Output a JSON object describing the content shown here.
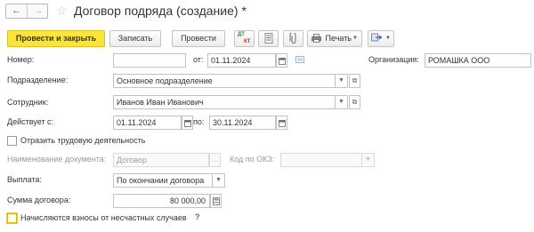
{
  "window": {
    "title": "Договор подряда (создание) *"
  },
  "nav": {
    "back": "←",
    "forward": "→"
  },
  "toolbar": {
    "post_close": "Провести и закрыть",
    "save": "Записать",
    "post": "Провести",
    "dtkt_top": "ДТ",
    "dtkt_bottom": "КТ",
    "print": "Печать"
  },
  "form": {
    "number_label": "Номер:",
    "number_value": "",
    "from_label": "от:",
    "date_value": "01.11.2024",
    "organization_label": "Организация:",
    "organization_value": "РОМАШКА ООО",
    "department_label": "Подразделение:",
    "department_value": "Основное подразделение",
    "employee_label": "Сотрудник:",
    "employee_value": "Иванов Иван Иванович",
    "valid_label": "Действует с:",
    "valid_from": "01.11.2024",
    "to_label": "по:",
    "valid_to": "30.11.2024",
    "labor_checkbox_label": "Отразить трудовую деятельность",
    "doc_name_label": "Наименование документа:",
    "doc_name_value": "Договор",
    "okz_label": "Код по ОКЗ:",
    "okz_value": "",
    "payment_label": "Выплата:",
    "payment_value": "По окончании договора",
    "sum_label": "Сумма договора:",
    "sum_value": "80 000,00",
    "accident_checkbox_label": "Начисляются взносы от несчастных случаев",
    "help_mark": "?"
  }
}
